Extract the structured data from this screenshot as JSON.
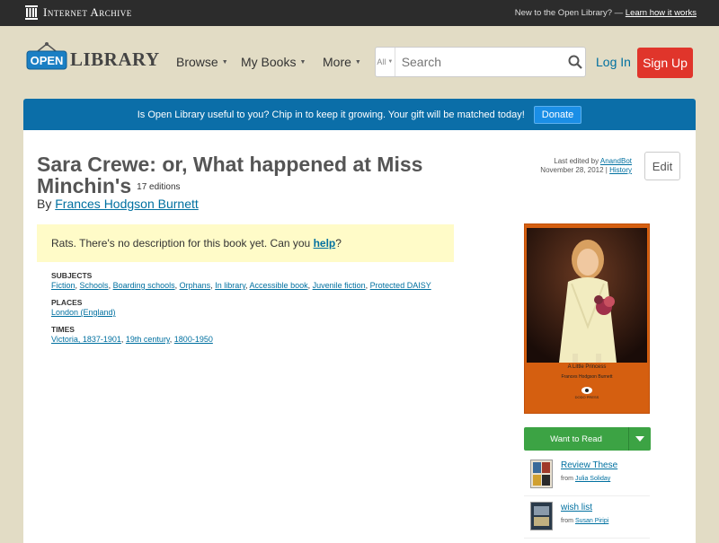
{
  "topbar": {
    "brand": "Internet Archive",
    "new_text": "New to the Open Library? —",
    "learn_link": "Learn how it works"
  },
  "header": {
    "logo_open": "OPEN",
    "logo_library": "LIBRARY",
    "nav": [
      {
        "label": "Browse"
      },
      {
        "label": "My Books"
      },
      {
        "label": "More"
      }
    ],
    "search_scope": "All",
    "search_placeholder": "Search",
    "login": "Log In",
    "signup": "Sign Up"
  },
  "banner": {
    "text": "Is Open Library useful to you? Chip in to keep it growing. Your gift will be matched today!",
    "donate": "Donate"
  },
  "book": {
    "title": "Sara Crewe: or, What happened at Miss Minchin's",
    "editions": "17 editions",
    "by": "By",
    "author": "Frances Hodgson Burnett",
    "last_edited_prefix": "Last edited by",
    "last_edited_by": "AnandBot",
    "last_edited_date": "November 28, 2012 |",
    "history": "History",
    "edit": "Edit",
    "desc_prefix": "Rats. There's no description for this book yet. Can you",
    "desc_link": "help",
    "desc_suffix": "?"
  },
  "facets": {
    "subjects_head": "SUBJECTS",
    "subjects": [
      "Fiction",
      "Schools",
      "Boarding schools",
      "Orphans",
      "In library",
      "Accessible book",
      "Juvenile fiction",
      "Protected DAISY"
    ],
    "places_head": "PLACES",
    "places": [
      "London (England)"
    ],
    "times_head": "TIMES",
    "times": [
      "Victoria, 1837-1901",
      "19th century",
      "1800-1950"
    ]
  },
  "cover": {
    "caption": "A Little Princess",
    "author": "Frances Hodgson Burnett",
    "publisher": "DODO PRESS"
  },
  "want_to_read": "Want to Read",
  "lists": [
    {
      "name": "Review These",
      "from": "from",
      "user": "Julia Soliday"
    },
    {
      "name": "wish list",
      "from": "from",
      "user": "Susan Piripi"
    }
  ],
  "colors": {
    "banner": "#0b6ea8",
    "signup": "#e0352b",
    "want": "#3ca344",
    "link": "#0070a0"
  }
}
